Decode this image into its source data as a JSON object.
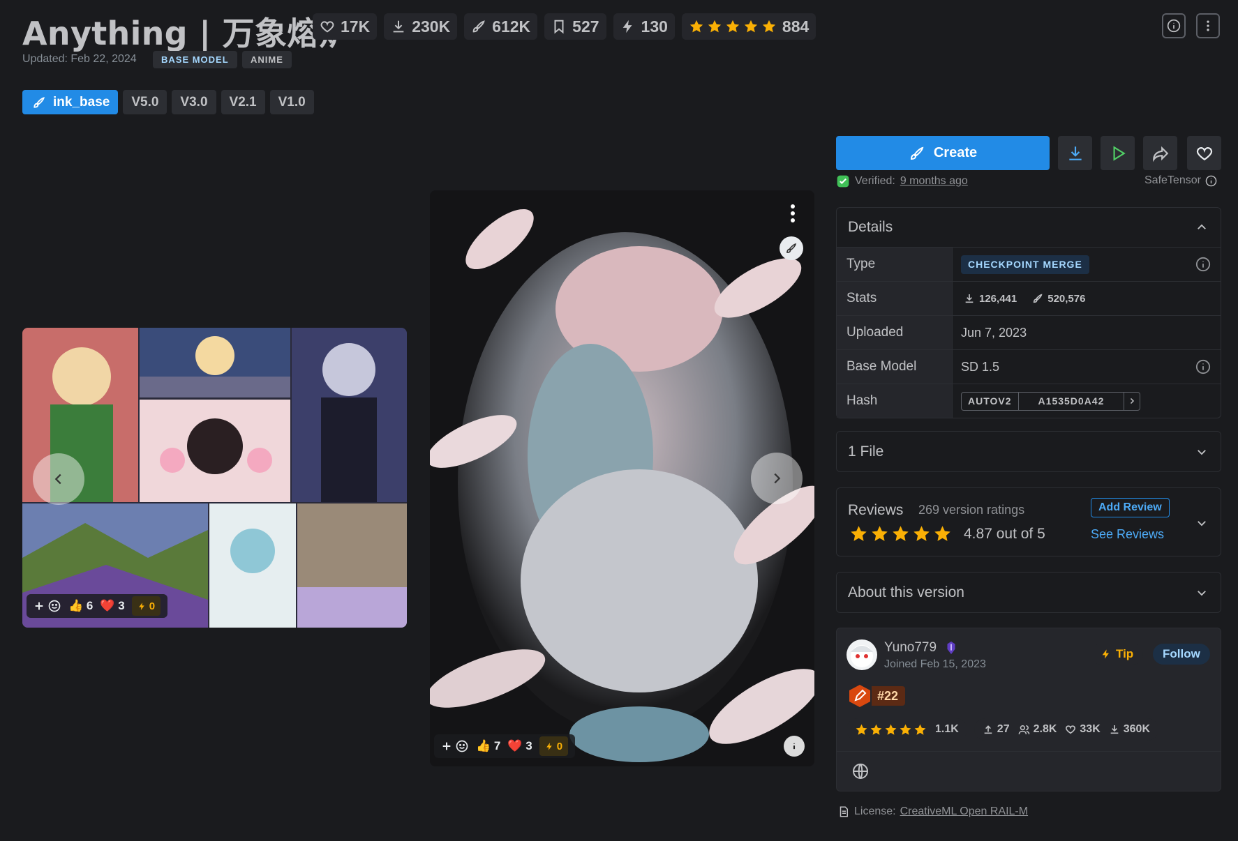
{
  "header": {
    "title": "Anything | 万象熔炉",
    "stats": {
      "likes": "17K",
      "downloads": "230K",
      "generations": "612K",
      "bookmarks": "527",
      "buzz": "130",
      "rating_count": "884",
      "rating_stars": 5
    },
    "updated": "Updated: Feb 22, 2024",
    "badges": [
      "BASE MODEL",
      "ANIME"
    ]
  },
  "versions": {
    "active": "ink_base",
    "others": [
      "V5.0",
      "V3.0",
      "V2.1",
      "V1.0"
    ]
  },
  "gallery": {
    "left_card": {
      "likes": "6",
      "hearts": "3",
      "buzz": "0"
    },
    "main_card": {
      "likes": "7",
      "hearts": "3",
      "buzz": "0"
    }
  },
  "actions": {
    "create_label": "Create",
    "verified_label": "Verified:",
    "verified_time": "9 months ago",
    "file_format": "SafeTensor"
  },
  "details": {
    "heading": "Details",
    "rows": {
      "type_label": "Type",
      "type_value": "CHECKPOINT MERGE",
      "stats_label": "Stats",
      "stats_downloads": "126,441",
      "stats_generations": "520,576",
      "uploaded_label": "Uploaded",
      "uploaded_value": "Jun 7, 2023",
      "base_model_label": "Base Model",
      "base_model_value": "SD 1.5",
      "hash_label": "Hash",
      "hash_type": "AUTOV2",
      "hash_value": "A1535D0A42"
    }
  },
  "files": {
    "heading": "1 File"
  },
  "reviews": {
    "heading": "Reviews",
    "count_text": "269 version ratings",
    "score_text": "4.87 out of 5",
    "add_review": "Add Review",
    "see_reviews": "See Reviews",
    "stars": 5
  },
  "about": {
    "heading": "About this version"
  },
  "creator": {
    "name": "Yuno779",
    "joined": "Joined Feb 15, 2023",
    "tip_label": "Tip",
    "follow_label": "Follow",
    "rank": "#22",
    "rating": "1.1K",
    "uploads": "27",
    "followers": "2.8K",
    "likes": "33K",
    "downloads": "360K"
  },
  "license": {
    "label": "License:",
    "value": "CreativeML Open RAIL-M"
  },
  "colors": {
    "background": "#1a1b1e",
    "accent": "#228be6",
    "star": "#fab005",
    "verified": "#40c057"
  }
}
